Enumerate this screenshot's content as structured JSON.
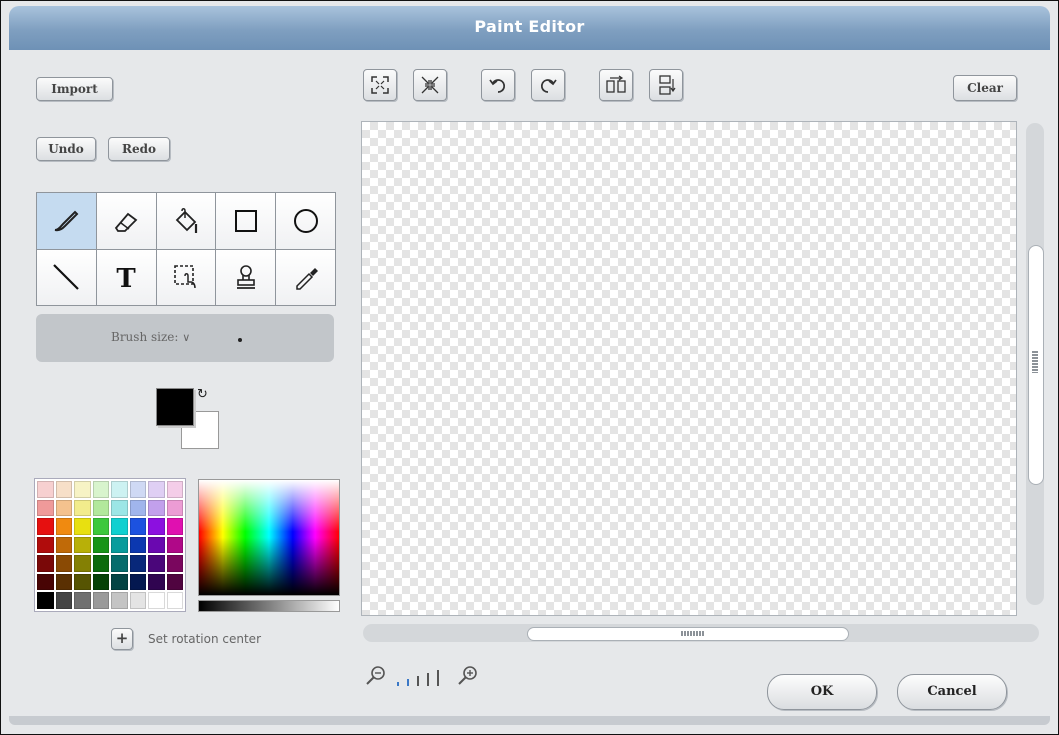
{
  "window": {
    "title": "Paint Editor"
  },
  "left": {
    "import_label": "Import",
    "undo_label": "Undo",
    "redo_label": "Redo",
    "tools": [
      {
        "name": "paintbrush-icon",
        "active": true
      },
      {
        "name": "eraser-icon",
        "active": false
      },
      {
        "name": "paint-bucket-icon",
        "active": false
      },
      {
        "name": "rectangle-icon",
        "active": false
      },
      {
        "name": "ellipse-icon",
        "active": false
      },
      {
        "name": "line-icon",
        "active": false
      },
      {
        "name": "text-icon",
        "active": false
      },
      {
        "name": "select-icon",
        "active": false
      },
      {
        "name": "stamp-icon",
        "active": false
      },
      {
        "name": "eyedropper-icon",
        "active": false
      }
    ],
    "brush_size_label": "Brush size:",
    "foreground_color": "#000000",
    "background_color": "#ffffff",
    "rotation_center_label": "Set rotation center"
  },
  "palette": [
    "#f7d0d0",
    "#f7dfc8",
    "#f7f3c5",
    "#d8f4cd",
    "#cdf2f2",
    "#cfd9f4",
    "#dfcff4",
    "#f4cde8",
    "#ef9a9a",
    "#f4c28e",
    "#f2ec8c",
    "#b2e89c",
    "#9ce6e6",
    "#a0b5ec",
    "#c2a0ec",
    "#ec9cd4",
    "#e61010",
    "#f08a10",
    "#e8e010",
    "#3cc83c",
    "#10d0d0",
    "#1c52e0",
    "#8c10e0",
    "#e010b0",
    "#b00c0c",
    "#c06a08",
    "#b8b008",
    "#189418",
    "#089c9c",
    "#0c38b0",
    "#6a08b0",
    "#b00888",
    "#7a0808",
    "#8a4a04",
    "#848004",
    "#0c6a0c",
    "#066c6c",
    "#08287a",
    "#4a067a",
    "#7a065e",
    "#480404",
    "#5a3002",
    "#565402",
    "#064206",
    "#034444",
    "#041850",
    "#300450",
    "#500440",
    "#000000",
    "#444444",
    "#707070",
    "#9a9a9a",
    "#c4c4c4",
    "#e4e4e4",
    "#ffffff",
    "#ffffff"
  ],
  "toolbar": {
    "buttons": [
      "grow-icon",
      "shrink-icon",
      "rotate-left-icon",
      "rotate-right-icon",
      "flip-horizontal-icon",
      "flip-vertical-icon"
    ],
    "clear_label": "Clear"
  },
  "footer": {
    "ok_label": "OK",
    "cancel_label": "Cancel"
  }
}
